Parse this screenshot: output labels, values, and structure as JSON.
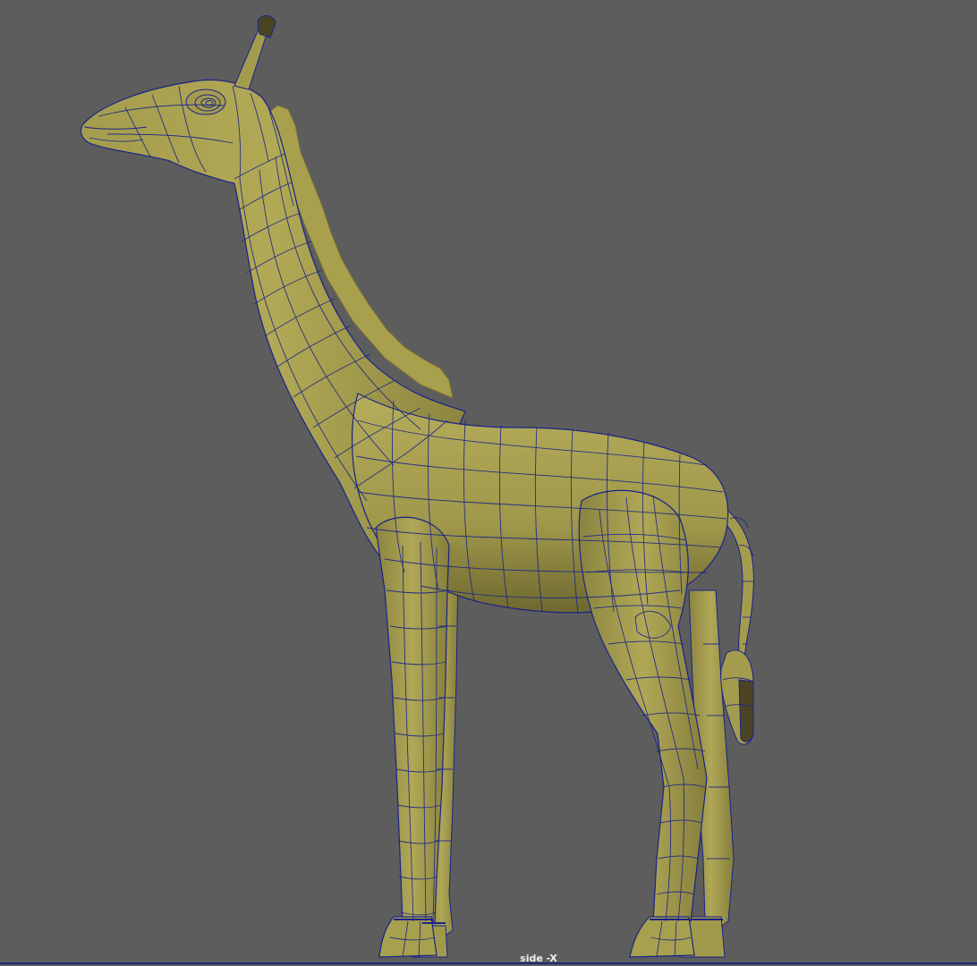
{
  "viewport": {
    "camera_name": "side -X",
    "model_name": "giraffe-mesh",
    "colors": {
      "background": "#5d5d5d",
      "mesh_fill": "#a29a4c",
      "mesh_shadow": "#6f6a30",
      "mesh_highlight": "#b8af5e",
      "wireframe": "#1a2388",
      "dark_parts": "#4a4424"
    }
  }
}
